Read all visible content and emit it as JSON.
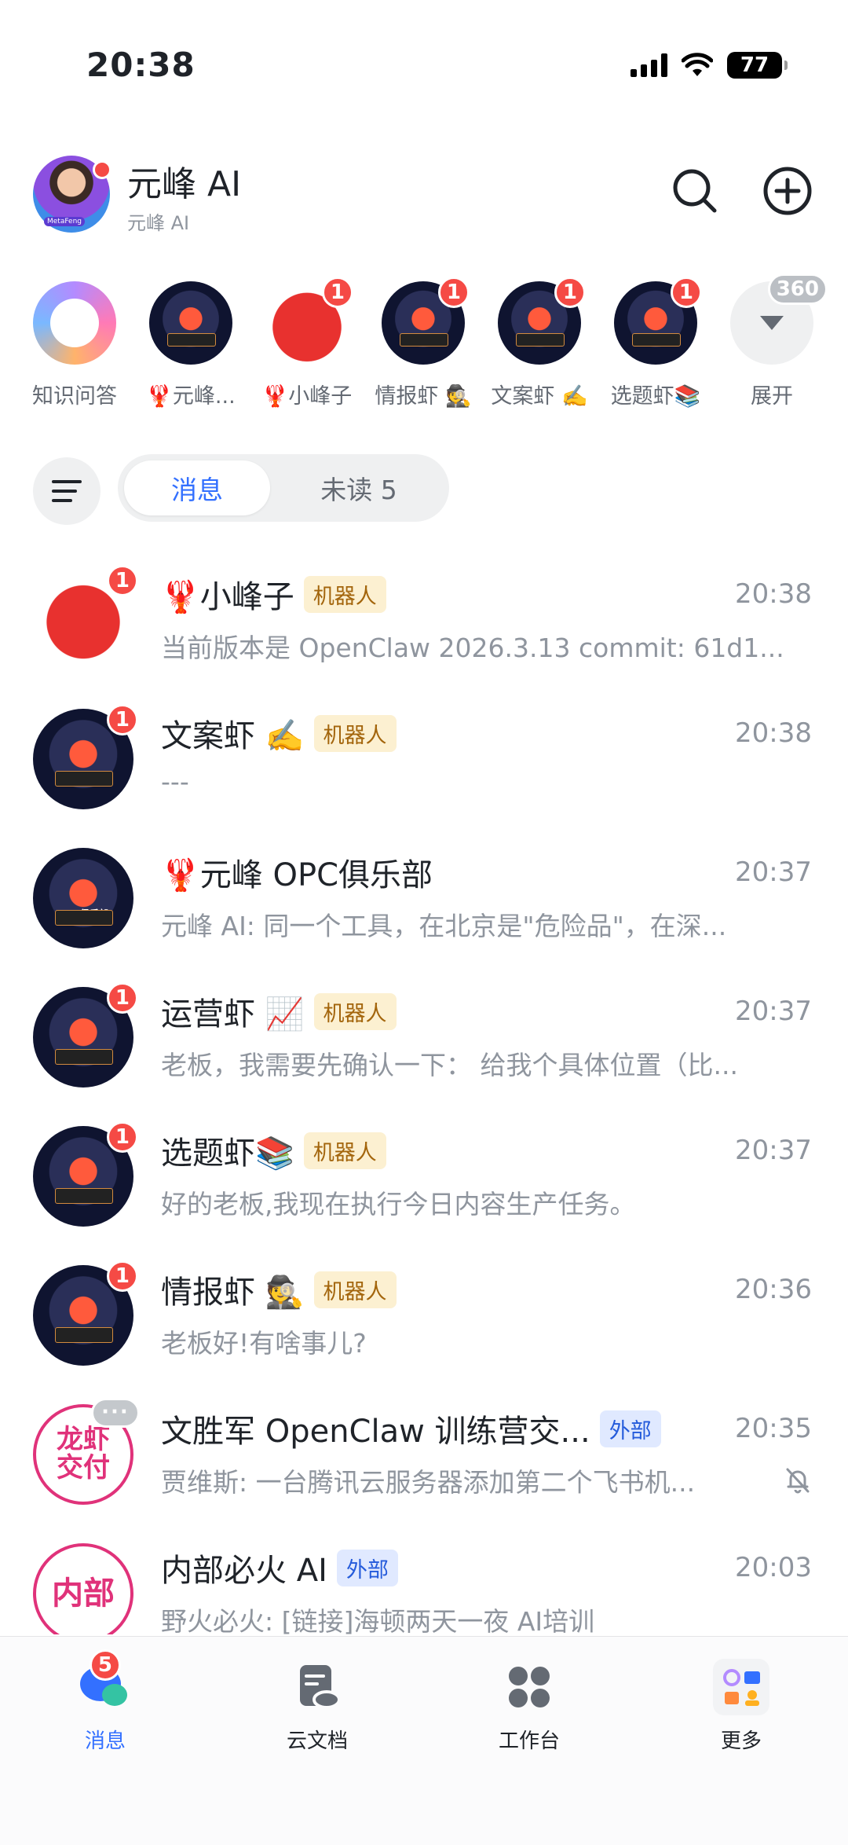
{
  "status_bar": {
    "time": "20:38",
    "battery": "77"
  },
  "header": {
    "title": "元峰 AI",
    "subtitle": "元峰 AI",
    "avatar_text": "MetaFeng"
  },
  "shortcuts": [
    {
      "label": "知识问答"
    },
    {
      "label": "🦞元峰..."
    },
    {
      "label": "🦞小峰子",
      "badge": "1"
    },
    {
      "label": "情报虾 🕵",
      "badge": "1"
    },
    {
      "label": "文案虾 ✍️",
      "badge": "1"
    },
    {
      "label": "选题虾📚",
      "badge": "1"
    },
    {
      "label": "展开",
      "badge": "360"
    }
  ],
  "filter": {
    "tab_messages": "消息",
    "tab_unread": "未读 5"
  },
  "chats": [
    {
      "name": "🦞小峰子",
      "tag": "机器人",
      "time": "20:38",
      "preview": "当前版本是 OpenClaw 2026.3.13 commit: 61d1...",
      "badge": "1"
    },
    {
      "name": "文案虾 ✍️",
      "tag": "机器人",
      "time": "20:38",
      "preview": "---",
      "badge": "1"
    },
    {
      "name": "🦞元峰 OPC俱乐部",
      "time": "20:37",
      "preview": "元峰 AI: 同一个工具，在北京是\"危险品\"，在深...",
      "avatar_text": "OPC俱乐部"
    },
    {
      "name": "运营虾 📈",
      "tag": "机器人",
      "time": "20:37",
      "preview": "老板，我需要先确认一下： 给我个具体位置（比...",
      "badge": "1"
    },
    {
      "name": "选题虾📚",
      "tag": "机器人",
      "time": "20:37",
      "preview": "好的老板,我现在执行今日内容生产任务。",
      "badge": "1"
    },
    {
      "name": "情报虾 🕵",
      "tag": "机器人",
      "time": "20:36",
      "preview": "老板好!有啥事儿?",
      "badge": "1"
    },
    {
      "name": "文胜军 OpenClaw 训练营交...",
      "tag": "外部",
      "time": "20:35",
      "preview": "贾维斯: 一台腾讯云服务器添加第二个飞书机...",
      "avatar_line1": "龙虾",
      "avatar_line2": "交付",
      "more": "···"
    },
    {
      "name": "内部必火 AI",
      "tag": "外部",
      "time": "20:03",
      "preview": "野火必火: [链接]海顿两天一夜 AI培训",
      "avatar_line1": "内部"
    }
  ],
  "tabbar": [
    {
      "label": "消息",
      "badge": "5"
    },
    {
      "label": "云文档"
    },
    {
      "label": "工作台"
    },
    {
      "label": "更多"
    }
  ]
}
